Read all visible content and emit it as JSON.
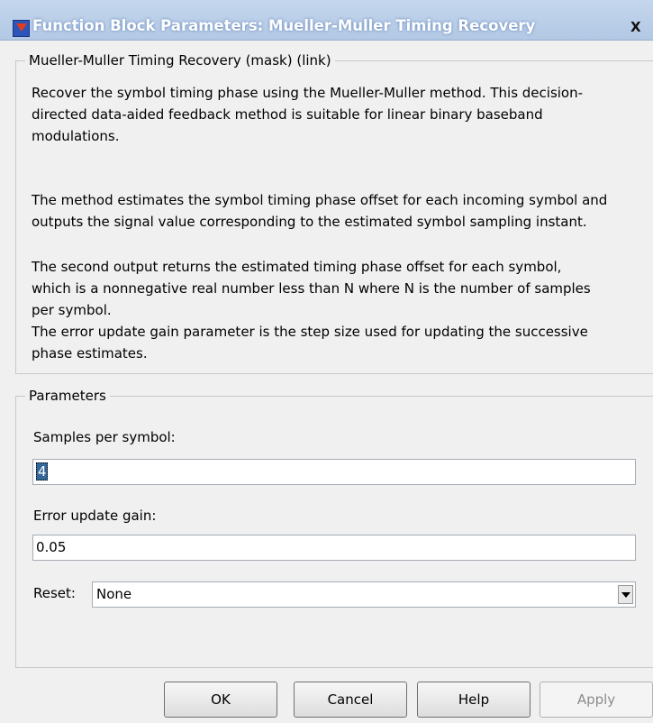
{
  "window": {
    "title": "Function Block Parameters: Mueller-Muller Timing Recovery",
    "close_label": "X"
  },
  "description_group": {
    "legend": "Mueller-Muller Timing Recovery (mask) (link)",
    "lines": [
      "Recover the symbol timing phase using the Mueller-Muller method. This decision-",
      "directed data-aided feedback method is suitable for linear binary baseband",
      "modulations.",
      "The method estimates the symbol timing phase offset for each incoming symbol and",
      "outputs the signal value corresponding to the estimated symbol sampling instant.",
      "The second output returns the estimated timing phase offset for each symbol,",
      "which is a nonnegative real number less than N where N is the number of samples",
      "per symbol.",
      "The error update gain parameter is the step size used for updating the successive",
      "phase estimates."
    ]
  },
  "parameters_group": {
    "legend": "Parameters",
    "samples_per_symbol": {
      "label": "Samples per symbol:",
      "value": "4"
    },
    "error_update_gain": {
      "label": "Error update gain:",
      "value": "0.05"
    },
    "reset": {
      "label": "Reset:",
      "value": "None"
    }
  },
  "buttons": {
    "ok": "OK",
    "cancel": "Cancel",
    "help": "Help",
    "apply": "Apply"
  },
  "colors": {
    "title_bar": "#b9cde8",
    "selection": "#336699"
  }
}
